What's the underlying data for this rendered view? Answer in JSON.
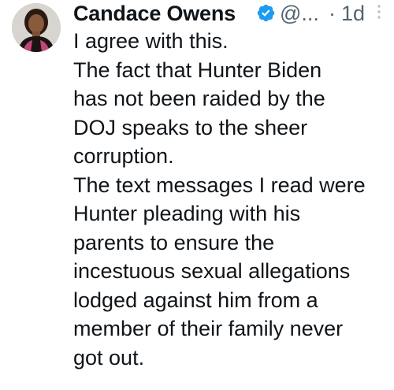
{
  "author": {
    "name": "Candace Owens",
    "handle": "@...",
    "separator": "·",
    "time": "1d",
    "avatar_icon": "profile-photo",
    "verified_icon": "verified-badge-icon",
    "verified_color": "#1d9bf0"
  },
  "more_icon": "more-options-icon",
  "text_lines": [
    "I agree with this.",
    "The fact that Hunter Biden",
    "has not been raided by the",
    "DOJ speaks to the sheer",
    "corruption.",
    "The text messages I read were",
    "Hunter pleading with his",
    "parents to ensure the",
    "incestuous sexual allegations",
    "lodged against him from a",
    "member of their family never",
    "got out."
  ]
}
